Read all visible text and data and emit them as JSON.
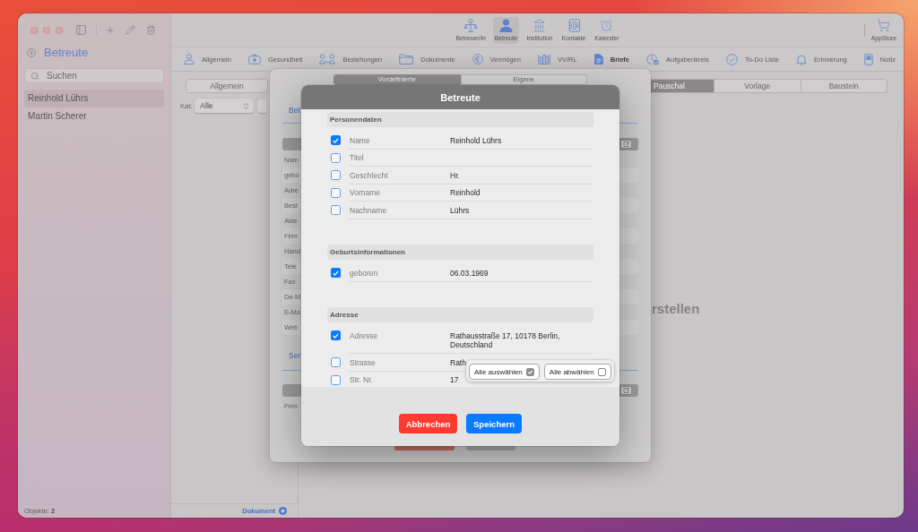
{
  "sidebar": {
    "title": "Betreute",
    "search": {
      "placeholder": "Suchen"
    },
    "items": [
      {
        "label": "Reinhold Lührs",
        "selected": true
      },
      {
        "label": "Martin Scherer",
        "selected": false
      }
    ],
    "footer": "Objekte: **2**"
  },
  "toolbar": {
    "items": [
      {
        "label": "Betreuer/in",
        "selected": false
      },
      {
        "label": "Betreute",
        "selected": true
      },
      {
        "label": "Institution",
        "selected": false
      },
      {
        "label": "Kontakte",
        "selected": false
      },
      {
        "label": "Kalender",
        "selected": false
      }
    ],
    "store": "AppStore"
  },
  "tabs": [
    {
      "label": "Allgemein",
      "selected": false
    },
    {
      "label": "Gesundheit",
      "selected": false
    },
    {
      "label": "Beziehungen",
      "selected": false
    },
    {
      "label": "Dokumente",
      "selected": false
    },
    {
      "label": "Vermögen",
      "selected": false
    },
    {
      "label": "VV/RL",
      "selected": false
    },
    {
      "label": "Briefe",
      "selected": true
    },
    {
      "label": "Aufgabenkreis",
      "selected": false
    },
    {
      "label": "To-Do Liste",
      "selected": false
    },
    {
      "label": "Erinnerung",
      "selected": false
    },
    {
      "label": "Notiz",
      "selected": false
    }
  ],
  "list_panel": {
    "filter": "Allgemein",
    "category": {
      "label": "Kat:",
      "value": "Alle"
    },
    "add_link": "Dokument"
  },
  "content": {
    "segments": [
      {
        "label": "Pauschal",
        "selected": true
      },
      {
        "label": "Vorlage",
        "selected": false
      },
      {
        "label": "Baustein",
        "selected": false
      }
    ],
    "heading": "rstellen"
  },
  "sheet": {
    "segments": [
      {
        "label": "Vordefinierte",
        "selected": true
      },
      {
        "label": "Eigene",
        "selected": false
      }
    ],
    "sections": [
      {
        "tab": "Bet",
        "rows": [
          "Nam",
          "gebo",
          "Adre",
          "Best",
          "Akte",
          "Firm",
          "Hand",
          "Tele",
          "Fax",
          "De-M",
          "E-Ma",
          "Web"
        ]
      },
      {
        "tab": "Ser",
        "rows": [
          "Firm"
        ]
      }
    ]
  },
  "dialog": {
    "title": "Betreute",
    "sections": [
      {
        "title": "Personendaten",
        "fields": [
          {
            "label": "Name",
            "value": "Reinhold Lührs",
            "checked": true
          },
          {
            "label": "Titel",
            "checked": false
          },
          {
            "label": "Geschlecht",
            "value": "Hr.",
            "checked": false
          },
          {
            "label": "Vorname",
            "value": "Reinhold",
            "checked": false
          },
          {
            "label": "Nachname",
            "value": "Lührs",
            "checked": false
          }
        ]
      },
      {
        "title": "Geburtsinformationen",
        "fields": [
          {
            "label": "geboren",
            "value": "06.03.1969",
            "checked": true
          }
        ]
      },
      {
        "title": "Adresse",
        "fields": [
          {
            "label": "Adresse",
            "value": "Rathausstraße 17, 10178 Berlin, Deutschland",
            "checked": true
          },
          {
            "label": "Strasse",
            "value": "Rath",
            "checked": false
          },
          {
            "label": "Str. Nr.",
            "value": "17",
            "checked": false
          }
        ]
      }
    ],
    "select_all": {
      "label": "Alle auswählen",
      "checked": true
    },
    "deselect_all": {
      "label": "Alle abwählen",
      "checked": false
    },
    "buttons": [
      {
        "label": "Abbrechen",
        "kind": "cancel"
      },
      {
        "label": "Speichern",
        "kind": "primary"
      }
    ]
  }
}
